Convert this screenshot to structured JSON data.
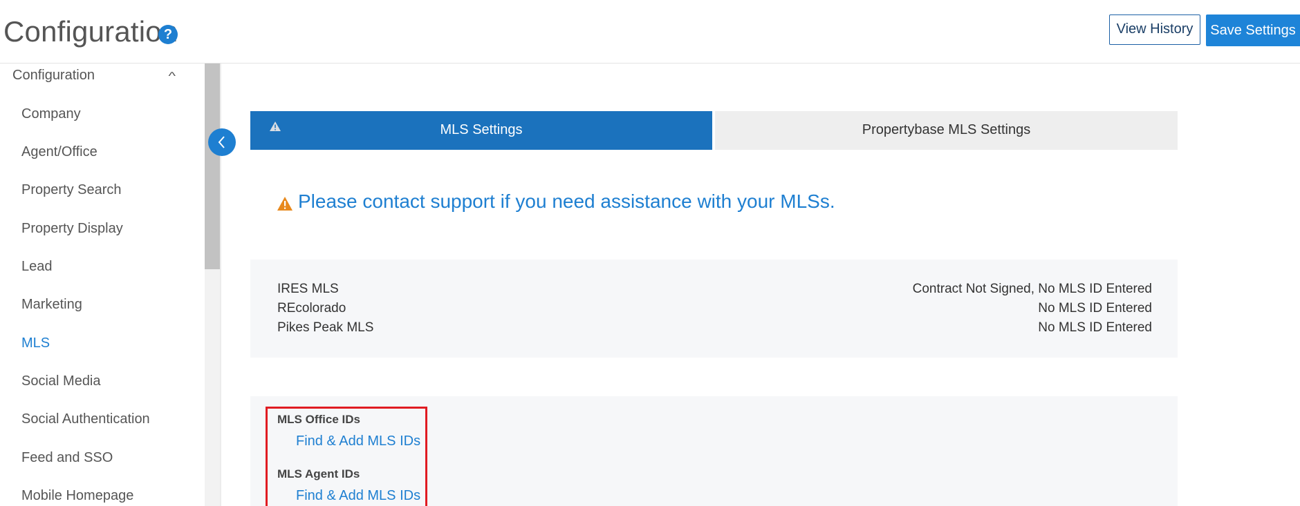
{
  "header": {
    "title": "Configuration",
    "help_icon": "question-circle-icon",
    "view_history_label": "View History",
    "save_settings_label": "Save Settings"
  },
  "sidebar": {
    "section_label": "Configuration",
    "section_chevron": "chevron-up-icon",
    "items": [
      {
        "label": "Company"
      },
      {
        "label": "Agent/Office"
      },
      {
        "label": "Property Search"
      },
      {
        "label": "Property Display"
      },
      {
        "label": "Lead"
      },
      {
        "label": "Marketing"
      },
      {
        "label": "MLS",
        "active": true
      },
      {
        "label": "Social Media"
      },
      {
        "label": "Social Authentication"
      },
      {
        "label": "Feed and SSO"
      },
      {
        "label": "Mobile Homepage"
      }
    ],
    "collapse_icon": "chevron-left-icon"
  },
  "tabs": [
    {
      "label": "MLS Settings",
      "active": true,
      "icon": "warning-icon"
    },
    {
      "label": "Propertybase MLS Settings",
      "active": false
    }
  ],
  "notice": {
    "icon": "warning-icon",
    "text": "Please contact support if you need assistance with your MLSs."
  },
  "mls_list": [
    {
      "name": "IRES MLS",
      "status": "Contract Not Signed, No MLS ID Entered"
    },
    {
      "name": "REcolorado",
      "status": "No MLS ID Entered"
    },
    {
      "name": "Pikes Peak MLS",
      "status": "No MLS ID Entered"
    }
  ],
  "ids": {
    "office_label": "MLS Office IDs",
    "office_link": "Find & Add MLS IDs",
    "agent_label": "MLS Agent IDs",
    "agent_link": "Find & Add MLS IDs"
  },
  "colors": {
    "accent": "#1e7fd1",
    "tab_active": "#1b72bd",
    "warning": "#e8891d",
    "highlight": "#e01b22"
  }
}
